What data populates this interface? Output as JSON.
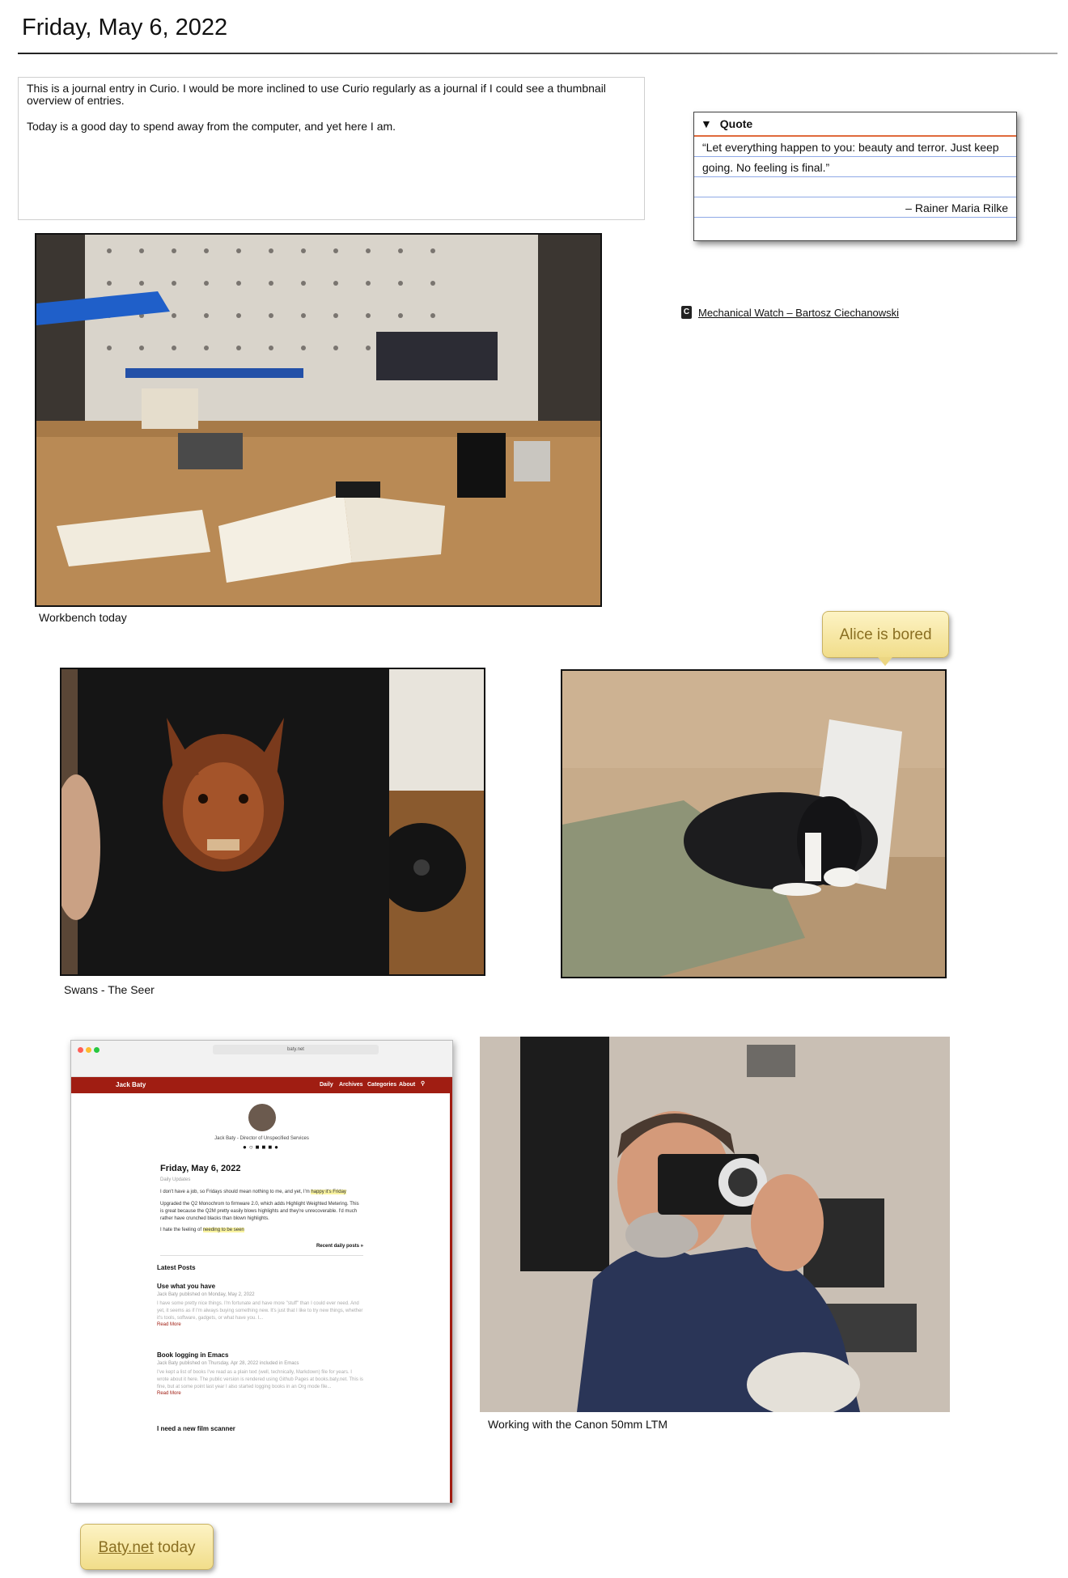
{
  "page": {
    "title": "Friday, May 6, 2022"
  },
  "journal": {
    "paragraph1": "This is a journal entry in Curio. I would be more inclined to use Curio regularly as a journal if I could see a thumbnail overview of entries.",
    "paragraph2": "Today is a good day to spend away from the computer, and yet here I am."
  },
  "quote": {
    "header": "Quote",
    "line1": "“Let everything happen to you: beauty and terror. Just keep",
    "line2": "going. No feeling is final.”",
    "attribution": "– Rainer Maria Rilke"
  },
  "link": {
    "icon": "C",
    "text": "Mechanical Watch – Bartosz Ciechanowski"
  },
  "images": {
    "workbench_caption": "Workbench today",
    "swans_caption": "Swans - The Seer",
    "alice_callout": "Alice is bored",
    "camera_caption": "Working with the Canon 50mm LTM",
    "baty_callout_link": "Baty.net",
    "baty_callout_rest": " today"
  },
  "browser": {
    "url": "baty.net",
    "site_name": "Jack Baty",
    "nav": [
      "Daily",
      "Archives",
      "Categories",
      "About"
    ],
    "tagline": "Jack Baty - Director of Unspecified Services",
    "post_title": "Friday, May 6, 2022",
    "post_meta": "Daily Updates",
    "post_p1_a": "I don't have a job, so Fridays should mean nothing to me, and yet, I'm ",
    "post_p1_hl": "happy it's Friday",
    "post_p2": "Upgraded the Q2 Monochrom to firmware 2.0, which adds Highlight Weighted Metering. This is great because the Q2M pretty easily blows highlights and they're unrecoverable. I'd much rather have crunched blacks than blown highlights.",
    "post_p3_a": "I hate the feeling of ",
    "post_p3_hl": "needing to be seen",
    "recent_link": "Recent daily posts »",
    "latest_heading": "Latest Posts",
    "post1_title": "Use what you have",
    "post1_meta": "Jack Baty published on Monday, May 2, 2022",
    "post1_body": "I have some pretty nice things. I'm fortunate and have more \"stuff\" than I could ever need. And yet, it seems as if I'm always buying something new. It's just that I like to try new things, whether it's tools, software, gadgets, or what have you. I...",
    "read_more": "Read More",
    "post2_title": "Book logging in Emacs",
    "post2_meta": "Jack Baty published on Thursday, Apr 28, 2022 included in Emacs",
    "post2_body": "I've kept a list of books I've read as a plain text (well, technically, Markdown) file for years. I wrote about it here. The public version is rendered using Github Pages at books.baty.net. This is fine, but at some point last year I also started logging books in an Org mode file...",
    "post3_title": "I need a new film scanner"
  },
  "colors": {
    "accent_red": "#a01d12",
    "callout_text": "#8a6f22",
    "quote_rule": "#e06a3c",
    "quote_lines": "#8fa9e6"
  }
}
